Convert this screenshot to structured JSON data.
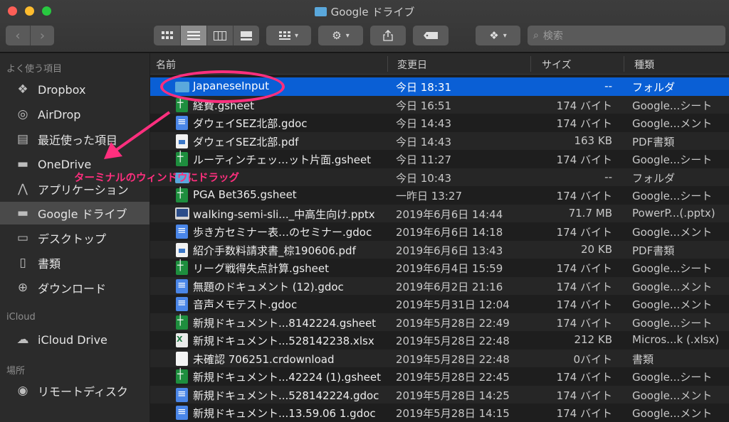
{
  "window": {
    "title": "Google ドライブ"
  },
  "toolbar": {
    "search_placeholder": "検索",
    "nav": {
      "back_icon": "chevron-left-icon",
      "forward_icon": "chevron-right-icon"
    },
    "views": [
      "icon-view",
      "list-view",
      "column-view",
      "gallery-view"
    ],
    "active_view": "list-view"
  },
  "sidebar": {
    "favorites_header": "よく使う項目",
    "favorites": [
      {
        "label": "Dropbox",
        "icon": "dropbox-icon"
      },
      {
        "label": "AirDrop",
        "icon": "airdrop-icon"
      },
      {
        "label": "最近使った項目",
        "icon": "recents-icon"
      },
      {
        "label": "OneDrive",
        "icon": "folder-icon"
      },
      {
        "label": "アプリケーション",
        "icon": "applications-icon"
      },
      {
        "label": "Google ドライブ",
        "icon": "folder-icon"
      },
      {
        "label": "デスクトップ",
        "icon": "desktop-icon"
      },
      {
        "label": "書類",
        "icon": "documents-icon"
      },
      {
        "label": "ダウンロード",
        "icon": "downloads-icon"
      }
    ],
    "selected_index": 5,
    "icloud_header": "iCloud",
    "icloud": [
      {
        "label": "iCloud Drive",
        "icon": "cloud-icon"
      }
    ],
    "places_header": "場所",
    "places": [
      {
        "label": "リモートディスク",
        "icon": "disc-icon"
      }
    ]
  },
  "columns": {
    "name": "名前",
    "date": "変更日",
    "size": "サイズ",
    "kind": "種類"
  },
  "files": [
    {
      "name": "JapaneseInput",
      "date": "今日 18:31",
      "size": "--",
      "kind": "フォルダ",
      "type": "folder"
    },
    {
      "name": "経費.gsheet",
      "date": "今日 16:51",
      "size": "174 バイト",
      "kind": "Google...シート",
      "type": "sheet"
    },
    {
      "name": "ダウェイSEZ北部.gdoc",
      "date": "今日 14:43",
      "size": "174 バイト",
      "kind": "Google...メント",
      "type": "doc"
    },
    {
      "name": "ダウェイSEZ北部.pdf",
      "date": "今日 14:43",
      "size": "163 KB",
      "kind": "PDF書類",
      "type": "pdf"
    },
    {
      "name": "ルーティンチェッ…ット片面.gsheet",
      "date": "今日 11:27",
      "size": "174 バイト",
      "kind": "Google...シート",
      "type": "sheet"
    },
    {
      "name": "",
      "date": "今日 10:43",
      "size": "--",
      "kind": "フォルダ",
      "type": "folder"
    },
    {
      "name": "PGA Bet365.gsheet",
      "date": "一昨日 13:27",
      "size": "174 バイト",
      "kind": "Google...シート",
      "type": "sheet"
    },
    {
      "name": "walking-semi-sli..._中高生向け.pptx",
      "date": "2019年6月6日 14:44",
      "size": "71.7 MB",
      "kind": "PowerP...(.pptx)",
      "type": "pptx"
    },
    {
      "name": "歩き方セミナー表…のセミナー.gdoc",
      "date": "2019年6月6日 14:18",
      "size": "174 バイト",
      "kind": "Google...メント",
      "type": "doc"
    },
    {
      "name": "紹介手数料請求書_棕190606.pdf",
      "date": "2019年6月6日 13:43",
      "size": "20 KB",
      "kind": "PDF書類",
      "type": "pdf"
    },
    {
      "name": "リーグ戦得失点計算.gsheet",
      "date": "2019年6月4日 15:59",
      "size": "174 バイト",
      "kind": "Google...シート",
      "type": "sheet"
    },
    {
      "name": "無題のドキュメント (12).gdoc",
      "date": "2019年6月2日 21:16",
      "size": "174 バイト",
      "kind": "Google...メント",
      "type": "doc"
    },
    {
      "name": "音声メモテスト.gdoc",
      "date": "2019年5月31日 12:04",
      "size": "174 バイト",
      "kind": "Google...メント",
      "type": "doc"
    },
    {
      "name": "新規ドキュメント...8142224.gsheet",
      "date": "2019年5月28日 22:49",
      "size": "174 バイト",
      "kind": "Google...シート",
      "type": "sheet"
    },
    {
      "name": "新規ドキュメント...528142238.xlsx",
      "date": "2019年5月28日 22:48",
      "size": "212 KB",
      "kind": "Micros...k (.xlsx)",
      "type": "xlsx"
    },
    {
      "name": "未確認 706251.crdownload",
      "date": "2019年5月28日 22:48",
      "size": "0バイト",
      "kind": "書類",
      "type": "blank"
    },
    {
      "name": "新規ドキュメント...42224 (1).gsheet",
      "date": "2019年5月28日 22:45",
      "size": "174 バイト",
      "kind": "Google...シート",
      "type": "sheet"
    },
    {
      "name": "新規ドキュメント...528142224.gdoc",
      "date": "2019年5月28日 14:25",
      "size": "174 バイト",
      "kind": "Google...メント",
      "type": "doc"
    },
    {
      "name": "新規ドキュメント...13.59.06 1.gdoc",
      "date": "2019年5月28日 14:15",
      "size": "174 バイト",
      "kind": "Google...メント",
      "type": "doc"
    }
  ],
  "selected_file_index": 0,
  "annotation": {
    "text": "ターミナルのウィンドウにドラッグ",
    "color": "#ff2f7e"
  }
}
